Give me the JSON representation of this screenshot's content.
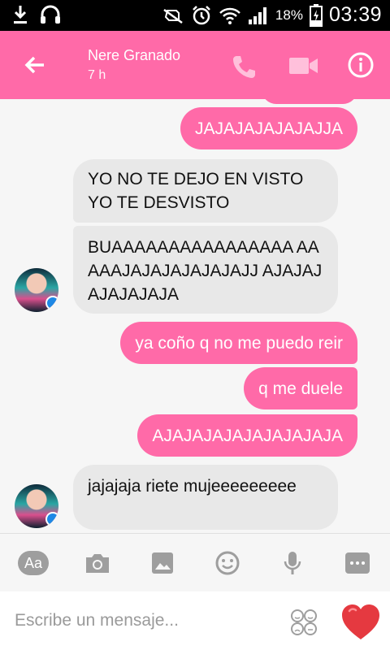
{
  "status_bar": {
    "battery_percent": "18%",
    "time": "03:39"
  },
  "header": {
    "contact_name": "Nere Granado",
    "last_active": "7 h"
  },
  "messages": [
    {
      "direction": "outgoing",
      "text": "JAJAJAJAJAJAJJA"
    },
    {
      "direction": "incoming",
      "text": "YO NO TE DEJO EN VISTO YO TE DESVISTO"
    },
    {
      "direction": "incoming",
      "text": "BUAAAAAAAAAAAAAAAA AAAAAJAJAJAJAJAJAJJ AJAJAJAJAJAJAJA"
    },
    {
      "direction": "outgoing",
      "text": "ya coño q no me puedo reir"
    },
    {
      "direction": "outgoing",
      "text": "q me duele"
    },
    {
      "direction": "outgoing",
      "text": "AJAJAJAJAJAJAJAJAJA"
    },
    {
      "direction": "incoming",
      "text": "jajajaja riete mujeeeeeeeee"
    }
  ],
  "toolbar": {
    "aa_label": "Aa",
    "icons": [
      "text-format-icon",
      "camera-icon",
      "gallery-icon",
      "emoji-icon",
      "microphone-icon",
      "more-icon"
    ]
  },
  "composer": {
    "placeholder": "Escribe un mensaje..."
  },
  "colors": {
    "accent": "#ff6aa8",
    "incoming_bubble": "#e8e8e8",
    "heart": "#e53940"
  }
}
